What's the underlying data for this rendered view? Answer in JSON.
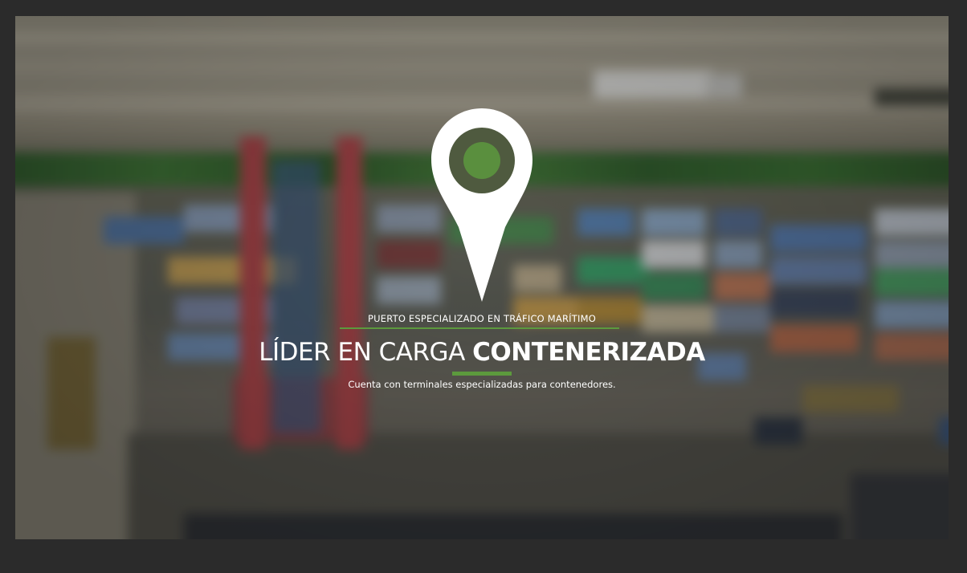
{
  "hero": {
    "background_description_icon": "container-port-aerial-image",
    "pin_icon": "map-pin-icon",
    "kicker": "PUERTO ESPECIALIZADO EN TRÁFICO MARÍTIMO",
    "headline_light": "LÍDER EN CARGA ",
    "headline_bold": "CONTENERIZADA",
    "subtitle": "Cuenta con terminales especializadas para contenedores."
  },
  "colors": {
    "accent": "#5c9a3d",
    "pin_dot": "#5a8f3e",
    "text": "#ffffff",
    "page_background": "#2b2b2b"
  }
}
